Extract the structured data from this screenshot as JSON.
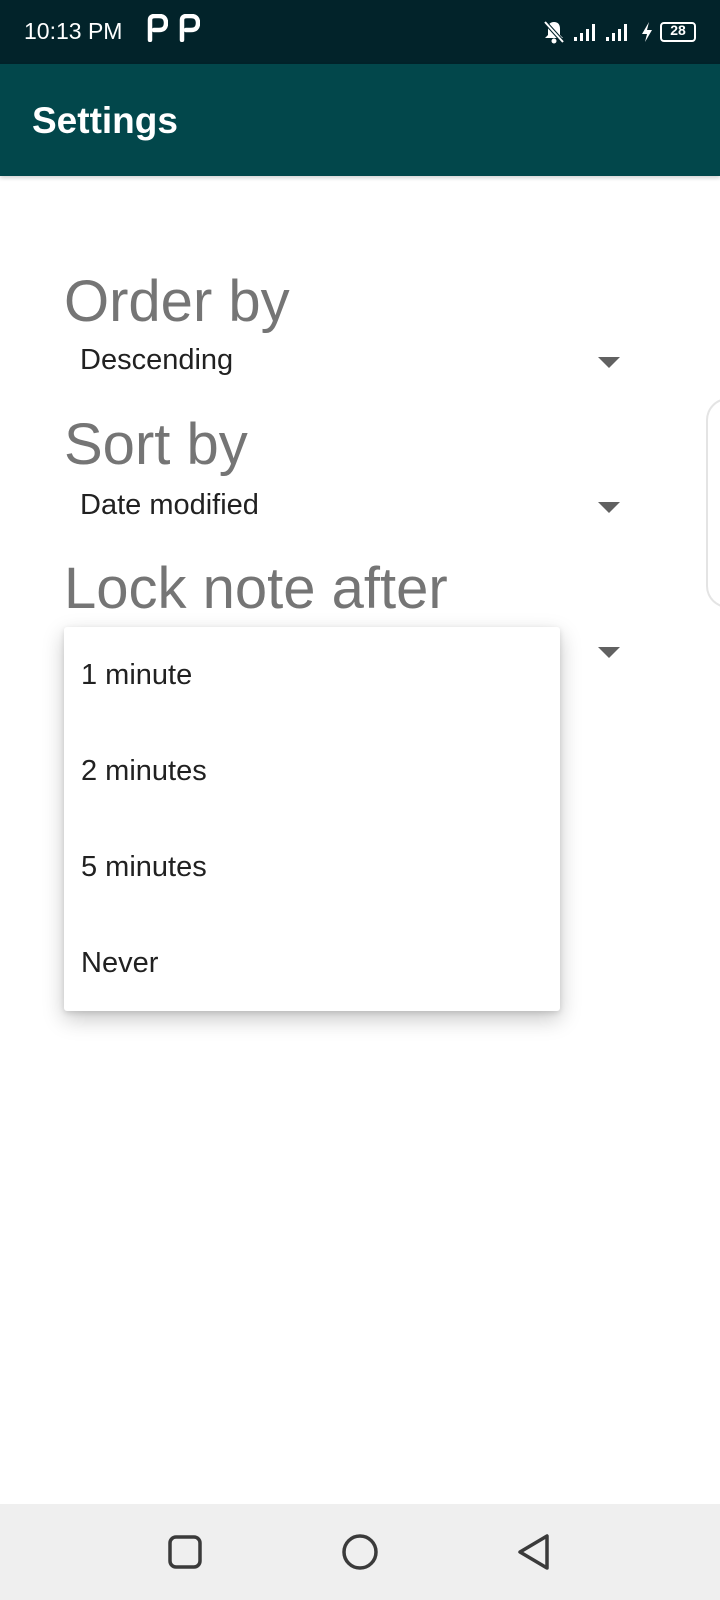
{
  "status_bar": {
    "time": "10:13 PM",
    "notification_icons": [
      "p-app-icon",
      "p-app-icon"
    ],
    "battery_level": "28",
    "icons": [
      "bell-muted-icon",
      "signal-icon",
      "signal-icon",
      "charging-icon",
      "battery-icon"
    ]
  },
  "app_bar": {
    "title": "Settings",
    "background": "#02474b"
  },
  "settings": {
    "order_by": {
      "label": "Order by",
      "value": "Descending"
    },
    "sort_by": {
      "label": "Sort by",
      "value": "Date modified"
    },
    "lock_note_after": {
      "label": "Lock note after"
    }
  },
  "lock_options": [
    "1 minute",
    "2 minutes",
    "5 minutes",
    "Never"
  ],
  "nav_bar": {
    "buttons": [
      "recents-square-icon",
      "home-circle-icon",
      "back-triangle-icon"
    ]
  },
  "colors": {
    "status_bar": "#02232a",
    "label_gray": "#757575",
    "text_dark": "#212121"
  }
}
